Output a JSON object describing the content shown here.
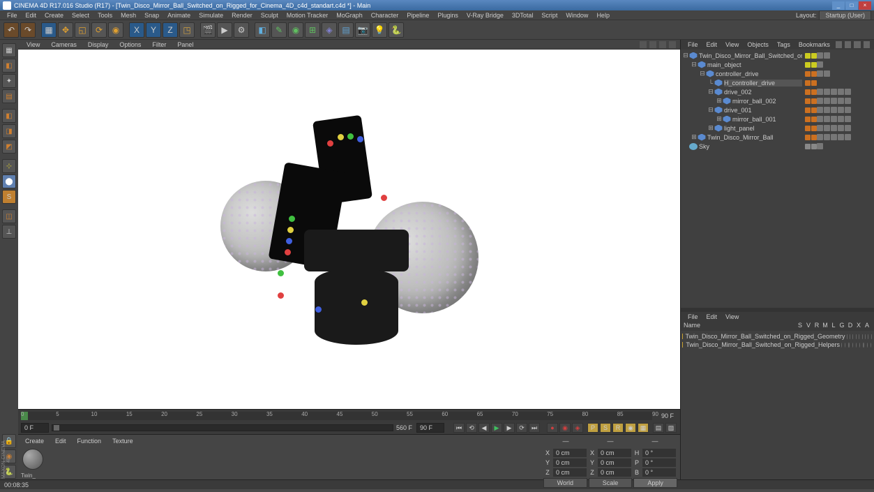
{
  "title": "CINEMA 4D R17.016 Studio (R17) - [Twin_Disco_Mirror_Ball_Switched_on_Rigged_for_Cinema_4D_c4d_standart.c4d *] - Main",
  "menubar": [
    "File",
    "Edit",
    "Create",
    "Select",
    "Tools",
    "Mesh",
    "Snap",
    "Animate",
    "Simulate",
    "Render",
    "Sculpt",
    "Motion Tracker",
    "MoGraph",
    "Character",
    "Pipeline",
    "Plugins",
    "V-Ray Bridge",
    "3DTotal",
    "Script",
    "Window",
    "Help"
  ],
  "layout_label": "Layout:",
  "layout_value": "Startup (User)",
  "viewport_menu": [
    "View",
    "Cameras",
    "Display",
    "Options",
    "Filter",
    "Panel"
  ],
  "timeline": {
    "ticks": [
      "0",
      "5",
      "10",
      "15",
      "20",
      "25",
      "30",
      "35",
      "40",
      "45",
      "50",
      "55",
      "60",
      "65",
      "70",
      "75",
      "80",
      "85",
      "90"
    ],
    "end": "90 F",
    "start_field": "0 F",
    "end_field": "90 F",
    "pos_field": "0 F"
  },
  "materials_menu": [
    "Create",
    "Edit",
    "Function",
    "Texture"
  ],
  "material_name": "Twin_",
  "coords": {
    "x": {
      "lbl": "X",
      "pos": "0 cm",
      "size_lbl": "X",
      "size": "0 cm",
      "rot_lbl": "H",
      "rot": "0 °"
    },
    "y": {
      "lbl": "Y",
      "pos": "0 cm",
      "size_lbl": "Y",
      "size": "0 cm",
      "rot_lbl": "P",
      "rot": "0 °"
    },
    "z": {
      "lbl": "Z",
      "pos": "0 cm",
      "size_lbl": "Z",
      "size": "0 cm",
      "rot_lbl": "B",
      "rot": "0 °"
    },
    "world": "World",
    "scale": "Scale",
    "apply": "Apply"
  },
  "obj_menu": [
    "File",
    "Edit",
    "View",
    "Objects",
    "Tags",
    "Bookmarks"
  ],
  "tree": [
    {
      "d": 0,
      "exp": "-",
      "name": "Twin_Disco_Mirror_Ball_Switched_on_Rigged",
      "dots": [
        "#cccc20",
        "#cccc20"
      ],
      "tags": 2
    },
    {
      "d": 1,
      "exp": "-",
      "name": "main_object",
      "dots": [
        "#cccc20",
        "#cccc20"
      ],
      "tags": 1
    },
    {
      "d": 2,
      "exp": "-",
      "name": "controller_drive",
      "dots": [
        "#cc7020",
        "#cc7020"
      ],
      "tags": 2
    },
    {
      "d": 3,
      "exp": "L",
      "name": "H_controller_drive",
      "dots": [
        "#cc7020",
        "#cc7020"
      ],
      "tags": 0,
      "ht": true
    },
    {
      "d": 3,
      "exp": "-",
      "name": "drive_002",
      "dots": [
        "#cc7020",
        "#cc7020"
      ],
      "tags": 5
    },
    {
      "d": 4,
      "exp": "+",
      "name": "mirror_ball_002",
      "dots": [
        "#cc7020",
        "#cc7020"
      ],
      "tags": 5
    },
    {
      "d": 3,
      "exp": "-",
      "name": "drive_001",
      "dots": [
        "#cc7020",
        "#cc7020"
      ],
      "tags": 5
    },
    {
      "d": 4,
      "exp": "+",
      "name": "mirror_ball_001",
      "dots": [
        "#cc7020",
        "#cc7020"
      ],
      "tags": 5
    },
    {
      "d": 3,
      "exp": "+",
      "name": "light_panel",
      "dots": [
        "#cc7020",
        "#cc7020"
      ],
      "tags": 5
    },
    {
      "d": 1,
      "exp": "+",
      "name": "Twin_Disco_Mirror_Ball",
      "dots": [
        "#cc7020",
        "#cc7020"
      ],
      "tags": 5
    },
    {
      "d": 0,
      "exp": "",
      "name": "Sky",
      "dots": [
        "#888",
        "#888"
      ],
      "tags": 1,
      "sky": true
    }
  ],
  "attr_menu": [
    "File",
    "Edit",
    "View"
  ],
  "layer_head": {
    "name": "Name",
    "cols": [
      "S",
      "V",
      "R",
      "M",
      "L",
      "G",
      "D",
      "X",
      "A"
    ]
  },
  "layers": [
    {
      "name": "Twin_Disco_Mirror_Ball_Switched_on_Rigged_Geometry"
    },
    {
      "name": "Twin_Disco_Mirror_Ball_Switched_on_Rigged_Helpers"
    }
  ],
  "status_time": "00:08:35",
  "brand": "MAXON CINEMA 4D"
}
